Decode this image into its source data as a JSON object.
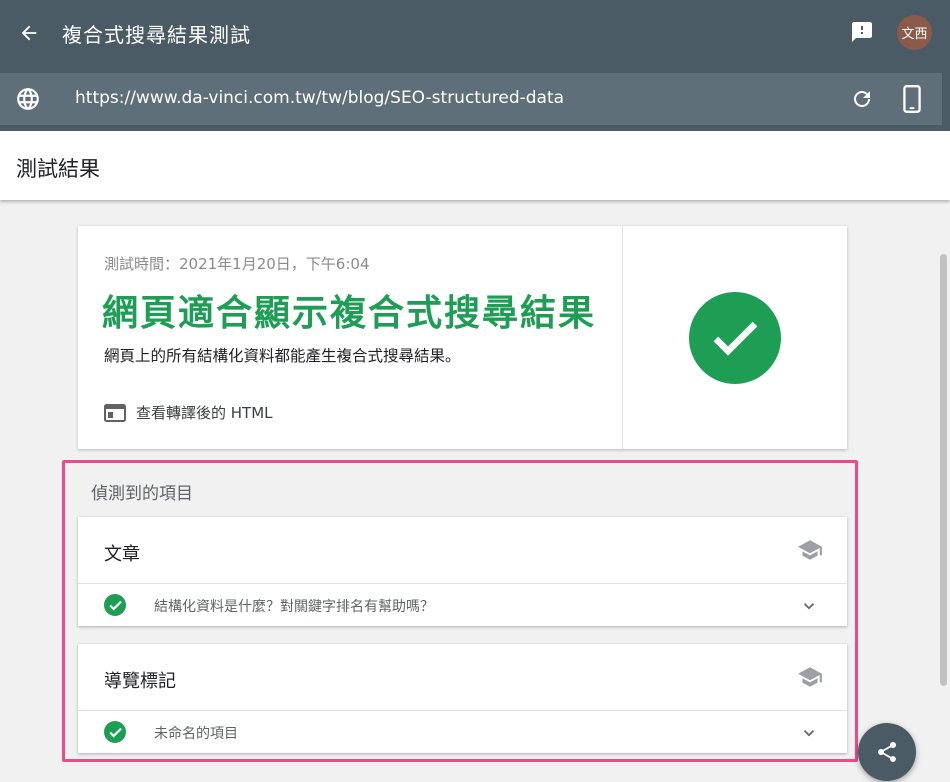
{
  "app": {
    "title": "複合式搜尋結果測試",
    "avatar_text": "文西",
    "back_icon": "arrow-left-icon",
    "feedback_icon": "feedback-icon"
  },
  "urlbar": {
    "url": "https://www.da-vinci.com.tw/tw/blog/SEO-structured-data",
    "globe_icon": "globe-icon",
    "refresh_icon": "refresh-icon",
    "device_icon": "smartphone-icon"
  },
  "results": {
    "title": "測試結果"
  },
  "summary": {
    "test_time": "測試時間：2021年1月20日，下午6:04",
    "headline": "網頁適合顯示複合式搜尋結果",
    "subline": "網頁上的所有結構化資料都能產生複合式搜尋結果。",
    "view_html_label": "查看轉譯後的 HTML",
    "status_color": "#1e9e55"
  },
  "detected": {
    "title": "偵測到的項目",
    "items": [
      {
        "title": "文章",
        "row_label": "結構化資料是什麼？對關鍵字排名有幫助嗎？"
      },
      {
        "title": "導覽標記",
        "row_label": "未命名的項目"
      }
    ]
  },
  "colors": {
    "topbar": "#4a5b66",
    "urlbar": "#5e6f7a",
    "success": "#1e9e55",
    "highlight": "#ec4b88"
  }
}
